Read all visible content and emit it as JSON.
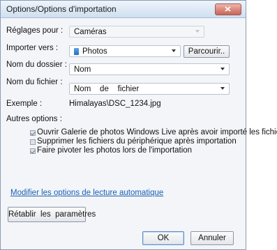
{
  "window": {
    "title": "Options/Options d'importation"
  },
  "settings_for": {
    "label": "Réglages pour :",
    "value": "Caméras"
  },
  "import_to": {
    "label": "Importer vers :",
    "value": "Photos",
    "browse_label": "Parcourir.."
  },
  "folder_name": {
    "label": "Nom du dossier :",
    "value": "Nom"
  },
  "file_name": {
    "label": "Nom du fichier :",
    "value": "Nom    de    fichier"
  },
  "example": {
    "label": "Exemple :",
    "value": "Himalayas\\DSC_1234.jpg"
  },
  "other_options": {
    "label": "Autres options :",
    "items": [
      {
        "label": "Ouvrir Galerie de photos Windows Live après avoir importé les fichiers",
        "checked": true
      },
      {
        "label": "Supprimer les fichiers du périphérique après importation",
        "checked": false
      },
      {
        "label": "Faire pivoter les photos lors de l'importation",
        "checked": true
      }
    ]
  },
  "autoplay_link": "Modifier les options de lecture automatique",
  "reset_button": "Rétablir  les  paramètres",
  "ok_button": "OK",
  "cancel_button": "Annuler"
}
